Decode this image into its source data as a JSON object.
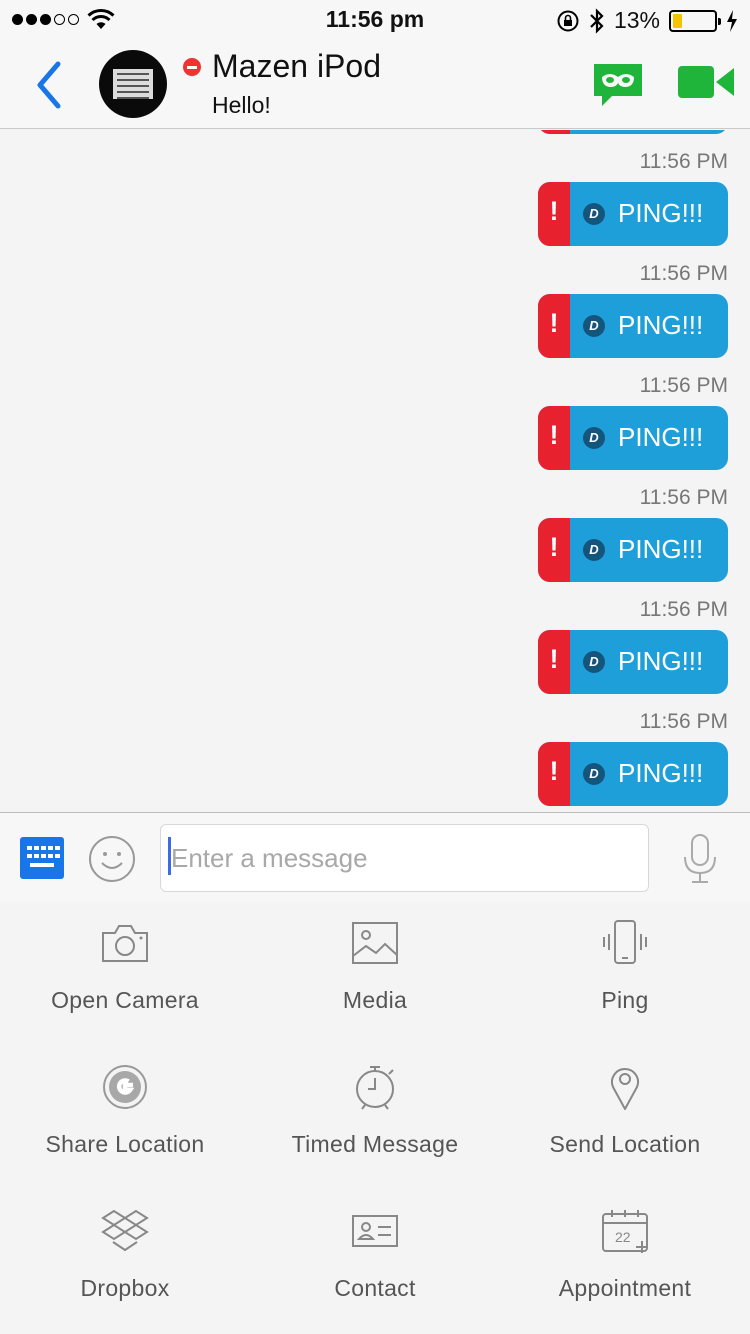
{
  "status_bar": {
    "time": "11:56 pm",
    "battery_percent": "13%",
    "signal_bars_filled": 3,
    "signal_bars_total": 5
  },
  "header": {
    "contact_name": "Mazen iPod",
    "contact_status": "Hello!",
    "presence_color": "#ee3333",
    "accent_color": "#1976e8",
    "call_icon_color": "#1fb53a"
  },
  "chat": {
    "messages": [
      {
        "time": "11:56 PM",
        "text": "PING!!!",
        "badge": "D",
        "error_mark": "!"
      },
      {
        "time": "11:56 PM",
        "text": "PING!!!",
        "badge": "D",
        "error_mark": "!"
      },
      {
        "time": "11:56 PM",
        "text": "PING!!!",
        "badge": "D",
        "error_mark": "!"
      },
      {
        "time": "11:56 PM",
        "text": "PING!!!",
        "badge": "D",
        "error_mark": "!"
      },
      {
        "time": "11:56 PM",
        "text": "PING!!!",
        "badge": "D",
        "error_mark": "!"
      },
      {
        "time": "11:56 PM",
        "text": "PING!!!",
        "badge": "D",
        "error_mark": "!"
      }
    ],
    "bubble_color": "#1f9fda",
    "error_color": "#e8212f"
  },
  "composer": {
    "placeholder": "Enter a message",
    "value": ""
  },
  "actions": [
    {
      "label": "Open Camera",
      "icon": "camera-icon"
    },
    {
      "label": "Media",
      "icon": "image-icon"
    },
    {
      "label": "Ping",
      "icon": "vibrating-phone-icon"
    },
    {
      "label": "Share Location",
      "icon": "google-icon"
    },
    {
      "label": "Timed Message",
      "icon": "timer-icon"
    },
    {
      "label": "Send Location",
      "icon": "map-pin-icon"
    },
    {
      "label": "Dropbox",
      "icon": "dropbox-icon"
    },
    {
      "label": "Contact",
      "icon": "contact-card-icon"
    },
    {
      "label": "Appointment",
      "icon": "calendar-add-icon"
    }
  ],
  "icons": {
    "appointment_day": "22"
  }
}
